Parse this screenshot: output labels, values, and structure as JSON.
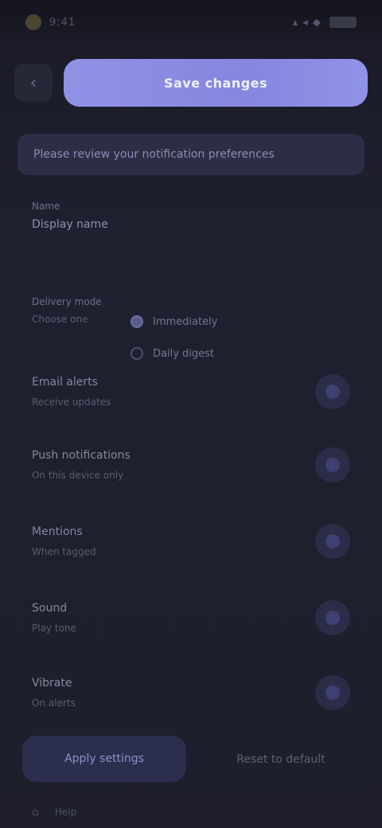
{
  "status_bar": {
    "time": "9:41",
    "icons": "▴ ◂ ◆",
    "app_icon": "app-dot-icon"
  },
  "topbar": {
    "back_icon": "‹",
    "primary_action_label": "Save changes"
  },
  "banner": {
    "text": "Please review your notification preferences"
  },
  "form": {
    "name": {
      "label": "Name",
      "value": "Display name"
    },
    "frequency": {
      "label": "Delivery mode",
      "sub": "Choose one",
      "options": [
        {
          "label": "Immediately",
          "selected": true
        },
        {
          "label": "Daily digest",
          "selected": false
        }
      ]
    }
  },
  "settings": [
    {
      "title": "Email alerts",
      "sub": "Receive updates"
    },
    {
      "title": "Push notifications",
      "sub": "On this device only"
    },
    {
      "title": "Mentions",
      "sub": "When tagged"
    },
    {
      "title": "Sound",
      "sub": "Play tone"
    },
    {
      "title": "Vibrate",
      "sub": "On alerts"
    }
  ],
  "buttons": {
    "save_label": "Apply settings",
    "cancel_label": "Reset to default"
  },
  "footer": {
    "icon": "⌂",
    "text": "Help"
  },
  "colors": {
    "accent": "#8587de",
    "background": "#1e1f2b",
    "banner": "#2c2e45"
  }
}
